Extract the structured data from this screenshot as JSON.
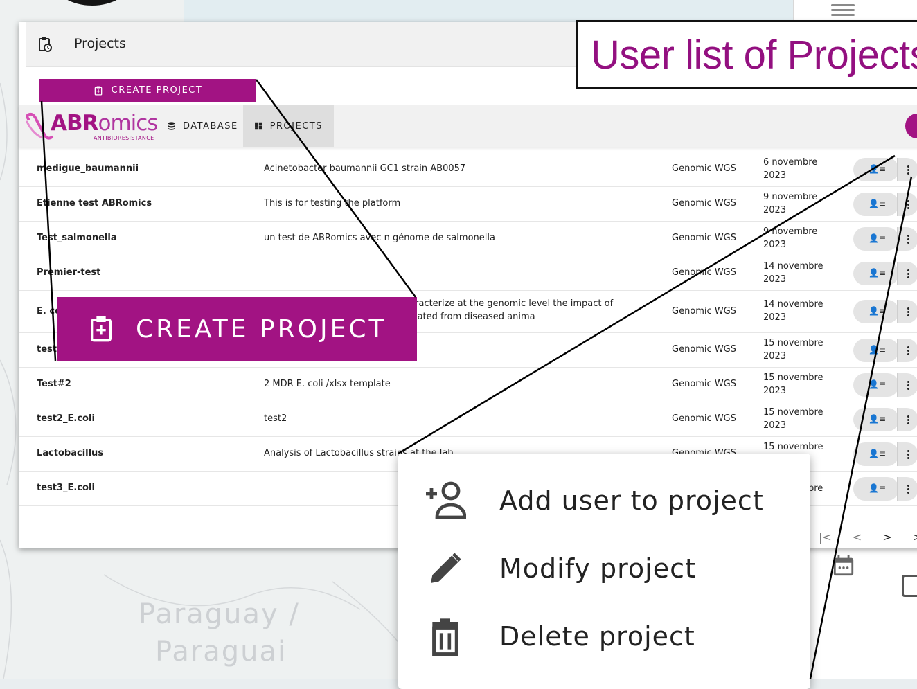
{
  "map": {
    "labels": [
      "Paraguay /",
      "Paraguai"
    ]
  },
  "window": {
    "title": "Projects"
  },
  "toolbar": {
    "create_label": "CREATE PROJECT"
  },
  "logo": {
    "brand_strong": "ABR",
    "brand_rest": "omics",
    "subtitle": "ANTIBIORESISTANCE"
  },
  "nav": {
    "database": "DATABASE",
    "projects": "PROJECTS"
  },
  "projects": [
    {
      "name": "medigue_baumannii",
      "description": "Acinetobacter baumannii GC1 strain AB0057",
      "type": "Genomic WGS",
      "date": "6 novembre 2023"
    },
    {
      "name": "Etienne test ABRomics",
      "description": "This is for testing the platform",
      "type": "Genomic WGS",
      "date": "9 novembre 2023"
    },
    {
      "name": "Test_salmonella",
      "description": "un test de ABRomics avec n génome de salmonella",
      "type": "Genomic WGS",
      "date": "9 novembre 2023"
    },
    {
      "name": "Premier-test",
      "description": "",
      "type": "Genomic WGS",
      "date": "14 novembre 2023"
    },
    {
      "name": "E. coli",
      "description": "The aim of the project was to characterize at the genomic level the impact of chang... mal. It concers E. coli isolated from diseased anima",
      "type": "Genomic WGS",
      "date": "14 novembre 2023"
    },
    {
      "name": "test",
      "description": "",
      "type": "Genomic WGS",
      "date": "15 novembre 2023"
    },
    {
      "name": "Test#2",
      "description": "2 MDR E. coli /xlsx template",
      "type": "Genomic WGS",
      "date": "15 novembre 2023"
    },
    {
      "name": "test2_E.coli",
      "description": "test2",
      "type": "Genomic WGS",
      "date": "15 novembre 2023"
    },
    {
      "name": "Lactobacillus",
      "description": "Analysis of Lactobacillus strains at the lab",
      "type": "Genomic WGS",
      "date": "15 novembre"
    },
    {
      "name": "test3_E.coli",
      "description": "",
      "type": "",
      "date": "bre"
    }
  ],
  "pager": {
    "first": "|<",
    "prev": "<",
    "next": ">",
    "last": ">"
  },
  "zoom": {
    "create_label": "CREATE PROJECT"
  },
  "callout": {
    "title": "User list of Projects"
  },
  "menu": {
    "add_user": "Add user to project",
    "modify": "Modify project",
    "delete": "Delete project"
  },
  "colors": {
    "brand": "#a21383",
    "callout_text": "#931080"
  }
}
